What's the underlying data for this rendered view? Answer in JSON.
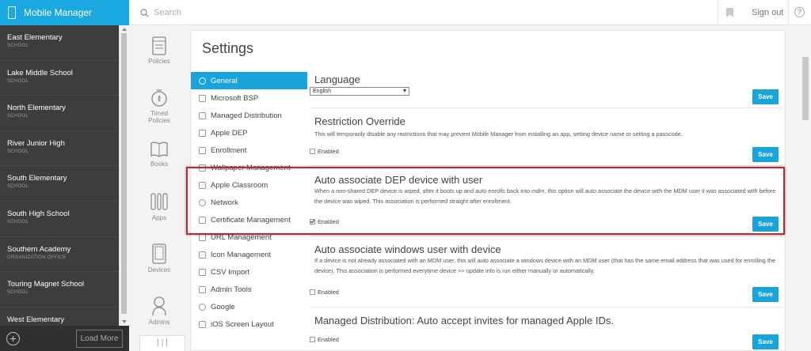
{
  "app": {
    "title": "Mobile Manager"
  },
  "search": {
    "placeholder": "Search"
  },
  "header": {
    "signout": "Sign out",
    "help": "?"
  },
  "schools": [
    {
      "name": "East Elementary",
      "kind": "SCHOOL"
    },
    {
      "name": "Lake Middle School",
      "kind": "SCHOOL"
    },
    {
      "name": "North Elementary",
      "kind": "SCHOOL"
    },
    {
      "name": "River Junior High",
      "kind": "SCHOOL"
    },
    {
      "name": "South Elementary",
      "kind": "SCHOOL"
    },
    {
      "name": "South High School",
      "kind": "SCHOOL"
    },
    {
      "name": "Southern Academy",
      "kind": "ORGANIZATION OFFICE"
    },
    {
      "name": "Touring Magnet School",
      "kind": "SCHOOL"
    },
    {
      "name": "West Elementary",
      "kind": ""
    }
  ],
  "sidebar_footer": {
    "add": "+",
    "load_more": "Load More"
  },
  "modules": [
    {
      "label": "Policies",
      "icon": "policies-icon"
    },
    {
      "label": "Timed Policies",
      "icon": "timer-icon"
    },
    {
      "label": "Books",
      "icon": "book-icon"
    },
    {
      "label": "Apps",
      "icon": "apps-icon"
    },
    {
      "label": "Devices",
      "icon": "tablet-icon"
    },
    {
      "label": "Admins",
      "icon": "user-icon"
    }
  ],
  "settings": {
    "title": "Settings",
    "nav": [
      "General",
      "Microsoft BSP",
      "Managed Distribution",
      "Apple DEP",
      "Enrollment",
      "Wallpaper Management",
      "Apple Classroom",
      "Network",
      "Certificate Management",
      "URL Management",
      "Icon Management",
      "CSV Import",
      "Admin Tools",
      "Google",
      "iOS Screen Layout"
    ],
    "active_nav": "General",
    "save_label": "Save",
    "enabled_label": "Enabled",
    "sections": {
      "language": {
        "title": "Language",
        "value": "English"
      },
      "restriction": {
        "title": "Restriction Override",
        "desc": "This will temporarily disable any restrictions that may prevent Mobile Manager from installing an app, setting device name or setting a passcode.",
        "enabled": false
      },
      "dep_assoc": {
        "title": "Auto associate DEP device with user",
        "desc": "When a non-shared DEP device is wiped, after it boots up and auto enrolls back into mdm, this option will auto associate the device with the MDM user it was associated with before the device was wiped. This association is performed straight after enrollment.",
        "enabled": true
      },
      "windows_assoc": {
        "title": "Auto associate windows user with device",
        "desc": "If a device is not already associated with an MDM user, this will auto associate a windows device with an MDM user (that has the same email address that was used for enrolling the device). This association is performed everytime device >> update info is run either manually or automatically.",
        "enabled": false
      },
      "managed_dist": {
        "title": "Managed Distribution: Auto accept invites for managed Apple IDs.",
        "enabled": false
      }
    }
  },
  "colors": {
    "accent": "#1aa4dc",
    "sidebar": "#3c3d3e",
    "highlight": "#c1272d"
  }
}
